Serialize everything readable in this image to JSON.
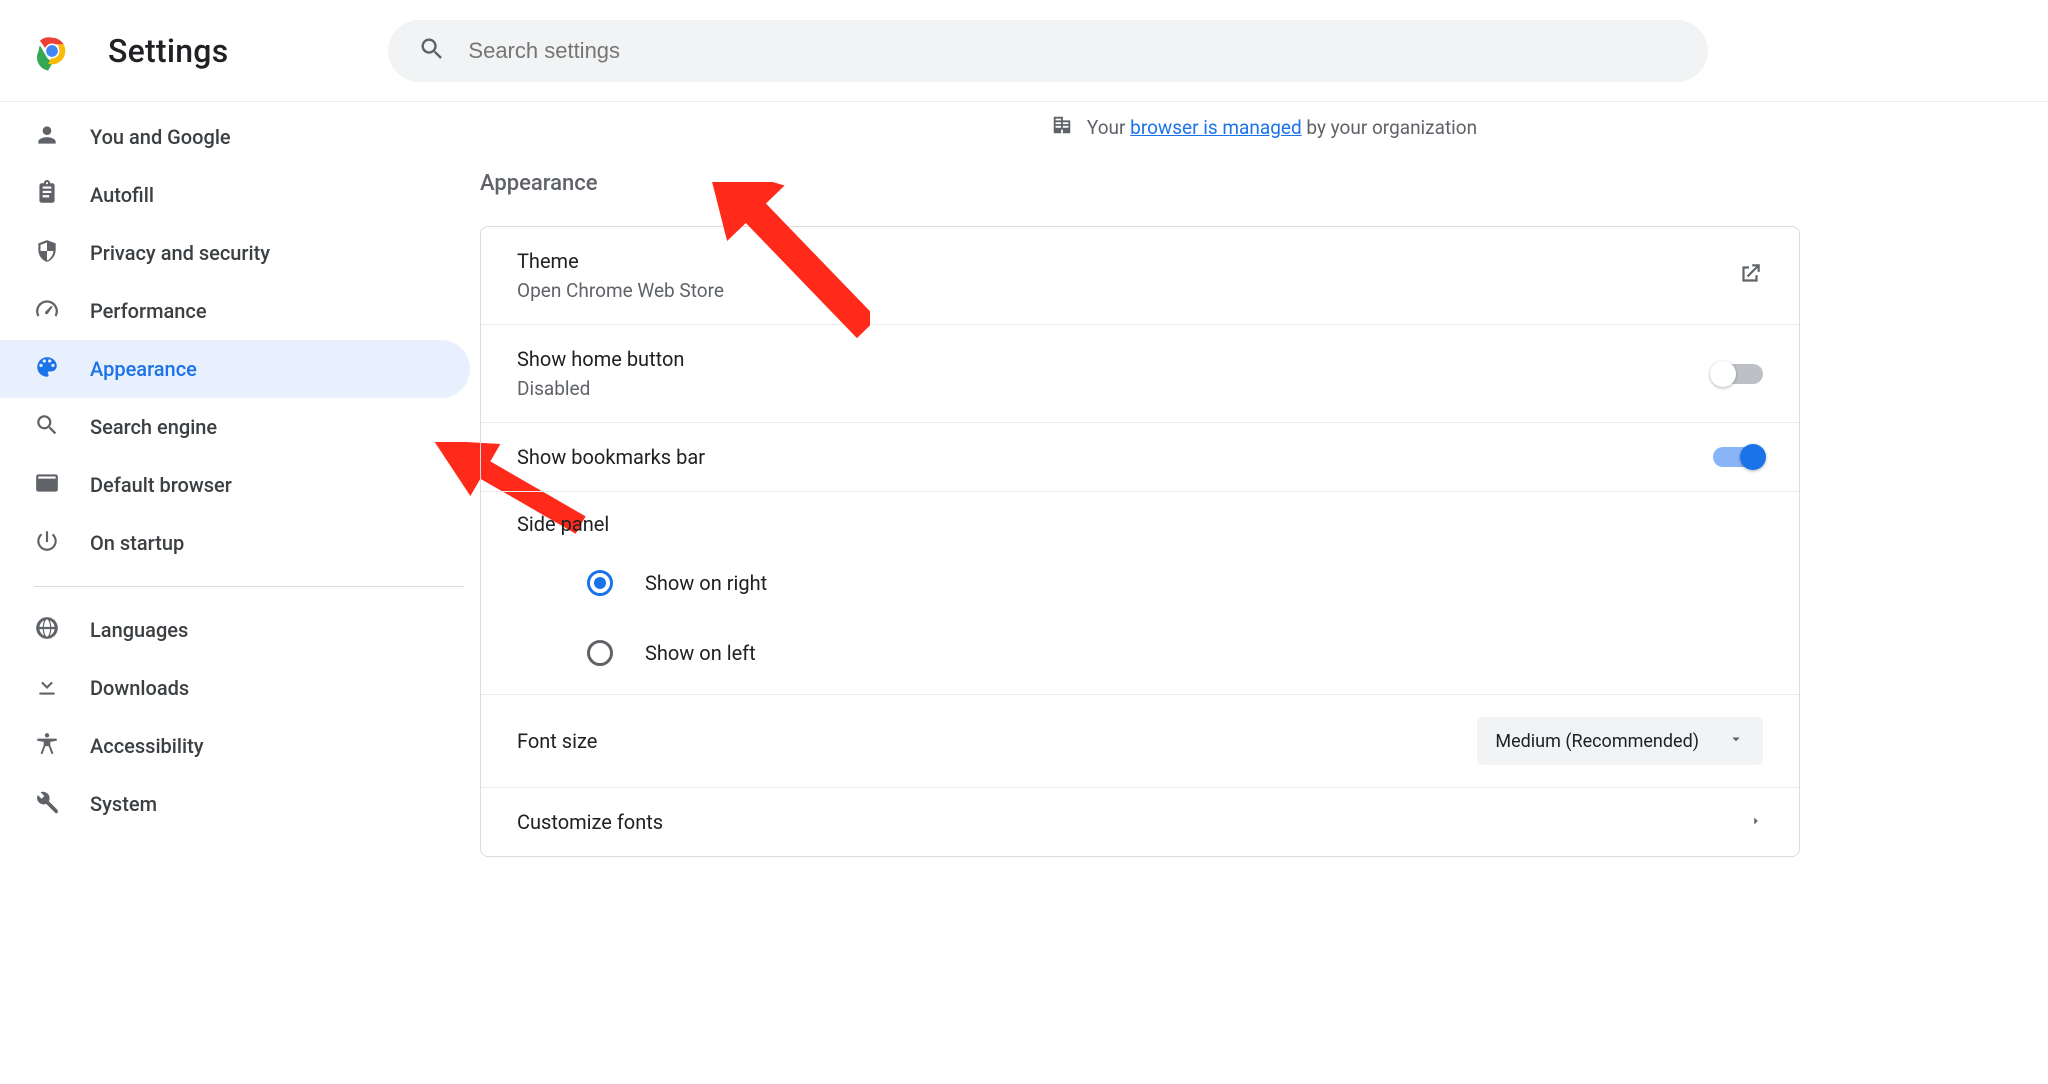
{
  "header": {
    "title": "Settings",
    "search_placeholder": "Search settings"
  },
  "sidebar": {
    "items": [
      {
        "id": "you-and-google",
        "label": "You and Google"
      },
      {
        "id": "autofill",
        "label": "Autofill"
      },
      {
        "id": "privacy",
        "label": "Privacy and security"
      },
      {
        "id": "performance",
        "label": "Performance"
      },
      {
        "id": "appearance",
        "label": "Appearance",
        "active": true
      },
      {
        "id": "search-engine",
        "label": "Search engine"
      },
      {
        "id": "default-browser",
        "label": "Default browser"
      },
      {
        "id": "on-startup",
        "label": "On startup"
      }
    ],
    "items2": [
      {
        "id": "languages",
        "label": "Languages"
      },
      {
        "id": "downloads",
        "label": "Downloads"
      },
      {
        "id": "accessibility",
        "label": "Accessibility"
      },
      {
        "id": "system",
        "label": "System"
      }
    ]
  },
  "main": {
    "managed_prefix": "Your ",
    "managed_link": "browser is managed",
    "managed_suffix": " by your organization",
    "section_title": "Appearance",
    "theme": {
      "title": "Theme",
      "sub": "Open Chrome Web Store"
    },
    "home_button": {
      "title": "Show home button",
      "sub": "Disabled",
      "enabled": false
    },
    "bookmarks_bar": {
      "title": "Show bookmarks bar",
      "enabled": true
    },
    "side_panel": {
      "title": "Side panel",
      "options": [
        {
          "label": "Show on right",
          "checked": true
        },
        {
          "label": "Show on left",
          "checked": false
        }
      ]
    },
    "font_size": {
      "title": "Font size",
      "value": "Medium (Recommended)"
    },
    "customize_fonts": {
      "title": "Customize fonts"
    }
  }
}
